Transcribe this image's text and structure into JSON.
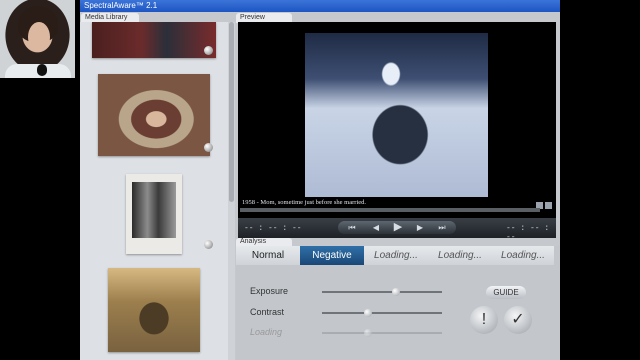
{
  "window": {
    "title": "SpectralAware™ 2.1"
  },
  "library": {
    "tab_label": "Media Library"
  },
  "preview": {
    "tab_label": "Preview",
    "caption": "1958 - Mom, sometime just before she married.",
    "time_left": "-- : -- : --",
    "time_right": "-- : -- : --",
    "transport": {
      "rewind": "⏮",
      "back": "◀",
      "play": "▶",
      "forward": "▶",
      "end": "⏭"
    }
  },
  "analysis": {
    "tab_label": "Analysis",
    "tabs": [
      {
        "label": "Normal"
      },
      {
        "label": "Negative"
      },
      {
        "label": "Loading..."
      },
      {
        "label": "Loading..."
      },
      {
        "label": "Loading..."
      }
    ],
    "rows": [
      {
        "label": "Exposure"
      },
      {
        "label": "Contrast"
      },
      {
        "label": "Loading"
      }
    ],
    "guide_label": "GUIDE",
    "alert_label": "!",
    "ok_label": "✓"
  }
}
